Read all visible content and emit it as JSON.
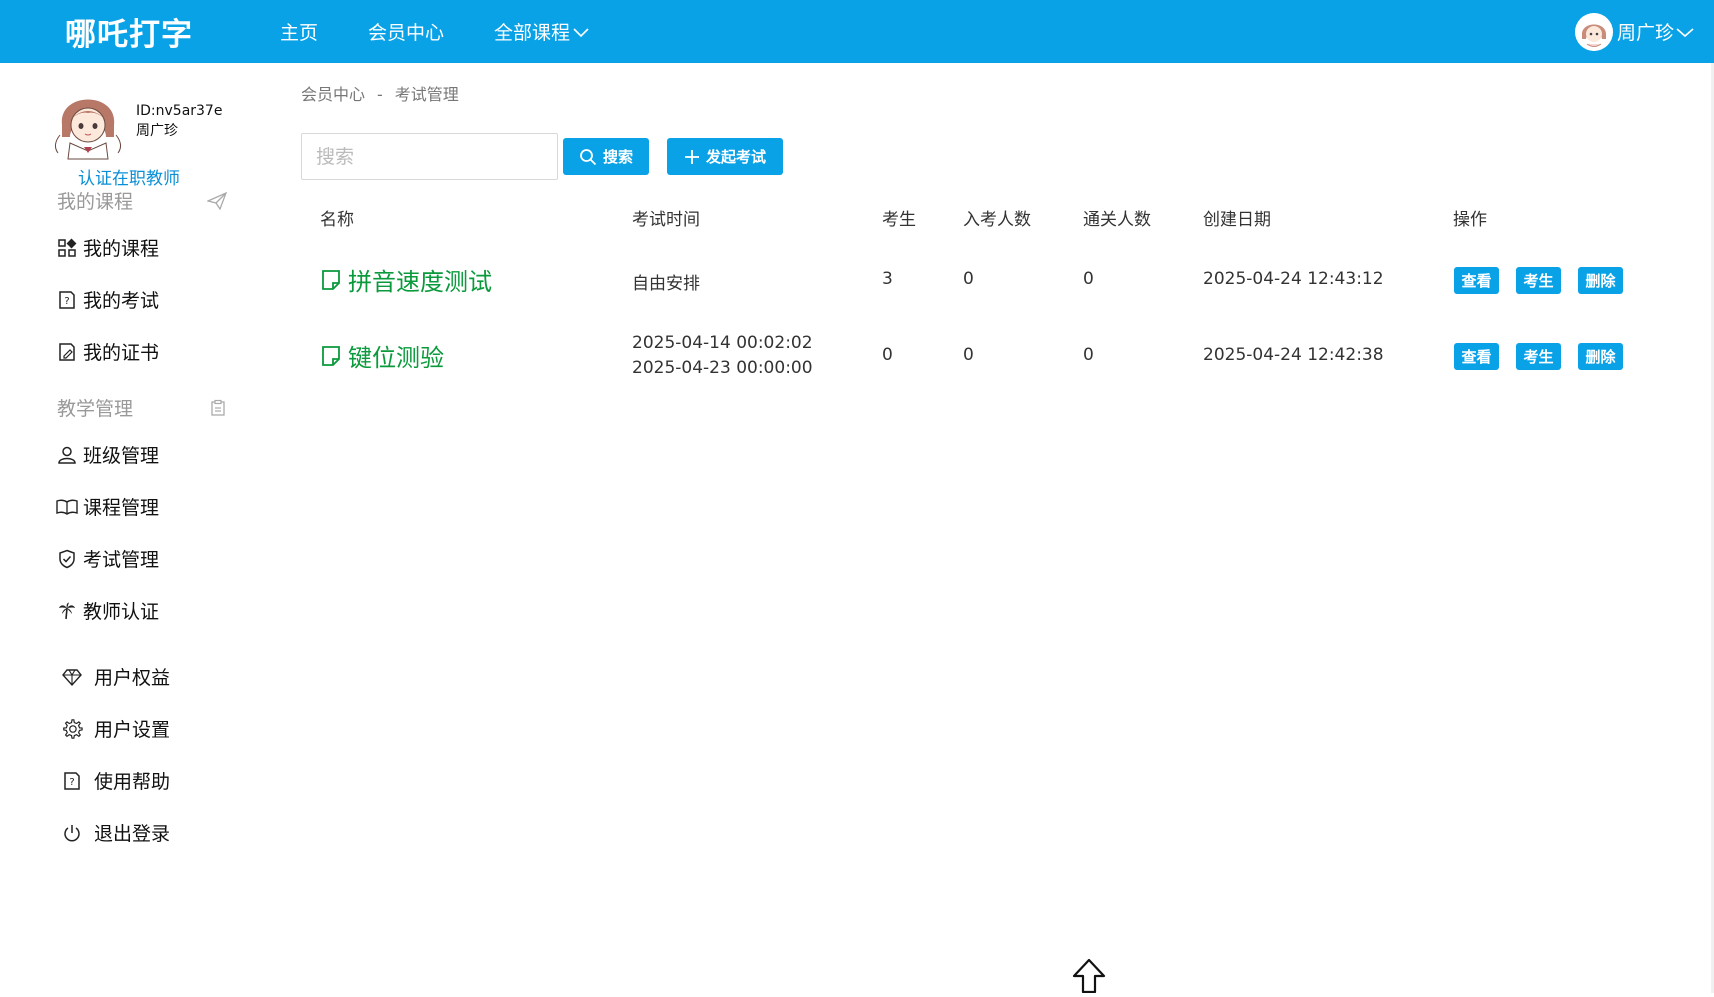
{
  "header": {
    "brand": "哪吒打字",
    "nav": [
      {
        "label": "主页"
      },
      {
        "label": "会员中心"
      },
      {
        "label": "全部课程"
      }
    ],
    "user_name": "周广珍"
  },
  "sidebar": {
    "user_id": "ID:nv5ar37e",
    "user_name": "周广珍",
    "certify_label": "认证在职教师",
    "section_courses": "我的课程",
    "courses_items": [
      {
        "label": "我的课程",
        "icon": "grid-icon"
      },
      {
        "label": "我的考试",
        "icon": "doc-question-icon"
      },
      {
        "label": "我的证书",
        "icon": "doc-edit-icon"
      }
    ],
    "section_teaching": "教学管理",
    "teaching_items": [
      {
        "label": "班级管理",
        "icon": "user-icon"
      },
      {
        "label": "课程管理",
        "icon": "book-icon"
      },
      {
        "label": "考试管理",
        "icon": "shield-check-icon"
      },
      {
        "label": "教师认证",
        "icon": "palm-icon"
      }
    ],
    "account_items": [
      {
        "label": "用户权益",
        "icon": "diamond-icon"
      },
      {
        "label": "用户设置",
        "icon": "gear-icon"
      },
      {
        "label": "使用帮助",
        "icon": "help-doc-icon"
      },
      {
        "label": "退出登录",
        "icon": "power-icon"
      }
    ]
  },
  "breadcrumb": {
    "parent": "会员中心",
    "separator": "-",
    "current": "考试管理"
  },
  "toolbar": {
    "search_placeholder": "搜索",
    "search_value": "",
    "search_button": "搜索",
    "create_button": "发起考试"
  },
  "table": {
    "headers": {
      "name": "名称",
      "time": "考试时间",
      "students": "考生",
      "entered": "入考人数",
      "passed": "通关人数",
      "created": "创建日期",
      "actions": "操作"
    },
    "rows": [
      {
        "name": "拼音速度测试",
        "time_line1": "自由安排",
        "time_line2": "",
        "students": "3",
        "entered": "0",
        "passed": "0",
        "created": "2025-04-24 12:43:12",
        "view": "查看",
        "examinees": "考生",
        "delete": "删除"
      },
      {
        "name": "键位测验",
        "time_line1": "2025-04-14 00:02:02",
        "time_line2": "2025-04-23 00:00:00",
        "students": "0",
        "entered": "0",
        "passed": "0",
        "created": "2025-04-24 12:42:38",
        "view": "查看",
        "examinees": "考生",
        "delete": "删除"
      }
    ]
  },
  "colors": {
    "primary": "#0aa2e7",
    "link_green": "#0a9a3c",
    "certify_blue": "#0a8fd6"
  }
}
